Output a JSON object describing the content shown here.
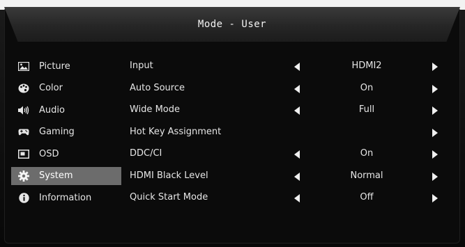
{
  "header": {
    "title": "Mode - User"
  },
  "sidebar": {
    "items": [
      {
        "label": "Picture",
        "icon": "picture-icon",
        "active": false
      },
      {
        "label": "Color",
        "icon": "palette-icon",
        "active": false
      },
      {
        "label": "Audio",
        "icon": "speaker-icon",
        "active": false
      },
      {
        "label": "Gaming",
        "icon": "gamepad-icon",
        "active": false
      },
      {
        "label": "OSD",
        "icon": "osd-icon",
        "active": false
      },
      {
        "label": "System",
        "icon": "gear-icon",
        "active": true
      },
      {
        "label": "Information",
        "icon": "info-icon",
        "active": false
      }
    ]
  },
  "settings": {
    "rows": [
      {
        "label": "Input",
        "value": "HDMI2",
        "left_arrow": true,
        "right_arrow": true
      },
      {
        "label": "Auto Source",
        "value": "On",
        "left_arrow": true,
        "right_arrow": true
      },
      {
        "label": "Wide Mode",
        "value": "Full",
        "left_arrow": true,
        "right_arrow": true
      },
      {
        "label": "Hot Key Assignment",
        "value": "",
        "left_arrow": false,
        "right_arrow": true
      },
      {
        "label": "DDC/CI",
        "value": "On",
        "left_arrow": true,
        "right_arrow": true
      },
      {
        "label": "HDMI Black Level",
        "value": "Normal",
        "left_arrow": true,
        "right_arrow": true
      },
      {
        "label": "Quick Start Mode",
        "value": "Off",
        "left_arrow": true,
        "right_arrow": true
      }
    ]
  },
  "colors": {
    "active_bg": "#6c6c6c",
    "panel_bg": "#0b0b0b",
    "text": "#e6e6e6"
  }
}
